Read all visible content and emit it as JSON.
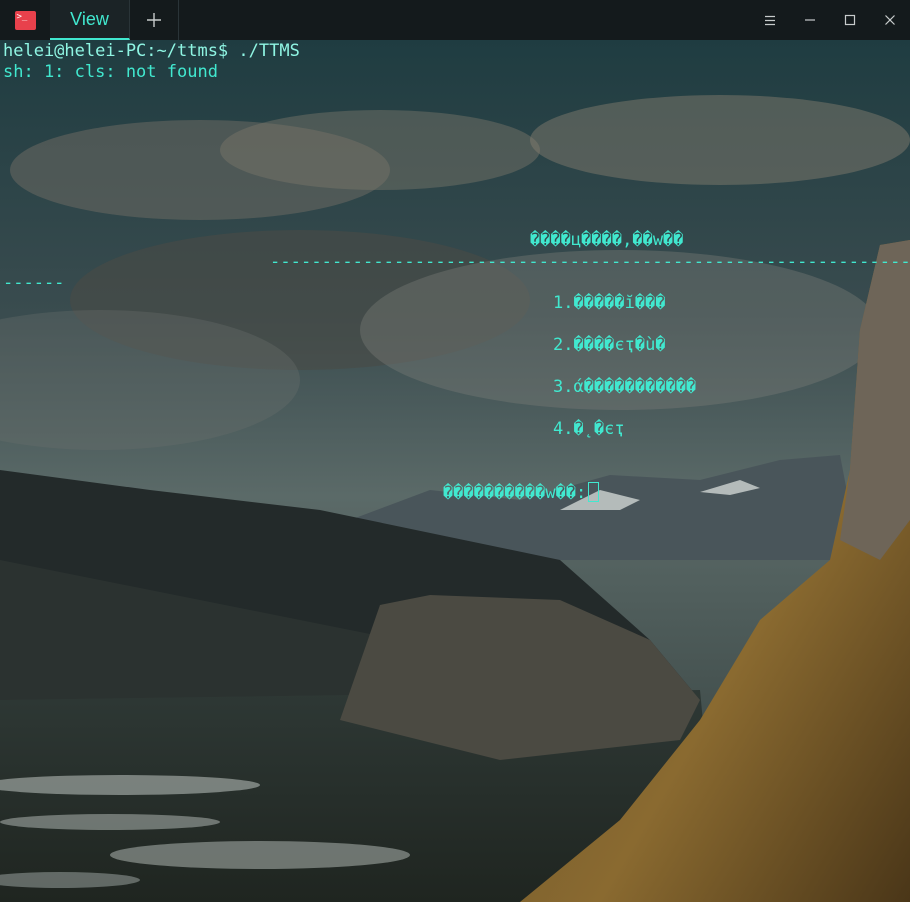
{
  "titlebar": {
    "app_icon": "terminal-icon",
    "tab_label": "View",
    "new_tab_icon": "plus-icon",
    "menu_icon": "hamburger-menu-icon",
    "minimize_icon": "minimize-icon",
    "maximize_icon": "maximize-icon",
    "close_icon": "close-icon"
  },
  "terminal": {
    "prompt": "helei@helei-PC:~/ttms$ ./TTMS",
    "error": "sh: 1: cls: not found",
    "menu_title": "����ц����,��w��",
    "separator_right": "-----------------------------------------------------------------",
    "separator_left": "------",
    "options": [
      "1.�����ĭ���",
      "2.����єҭ�ù�",
      "3.ά�����������",
      "4.�˛�єҭ"
    ],
    "input_prompt": "����������w��:"
  },
  "colors": {
    "accent": "#41e8cf",
    "titlebar_bg": "#141a1c",
    "app_icon_bg": "#e8414c"
  }
}
